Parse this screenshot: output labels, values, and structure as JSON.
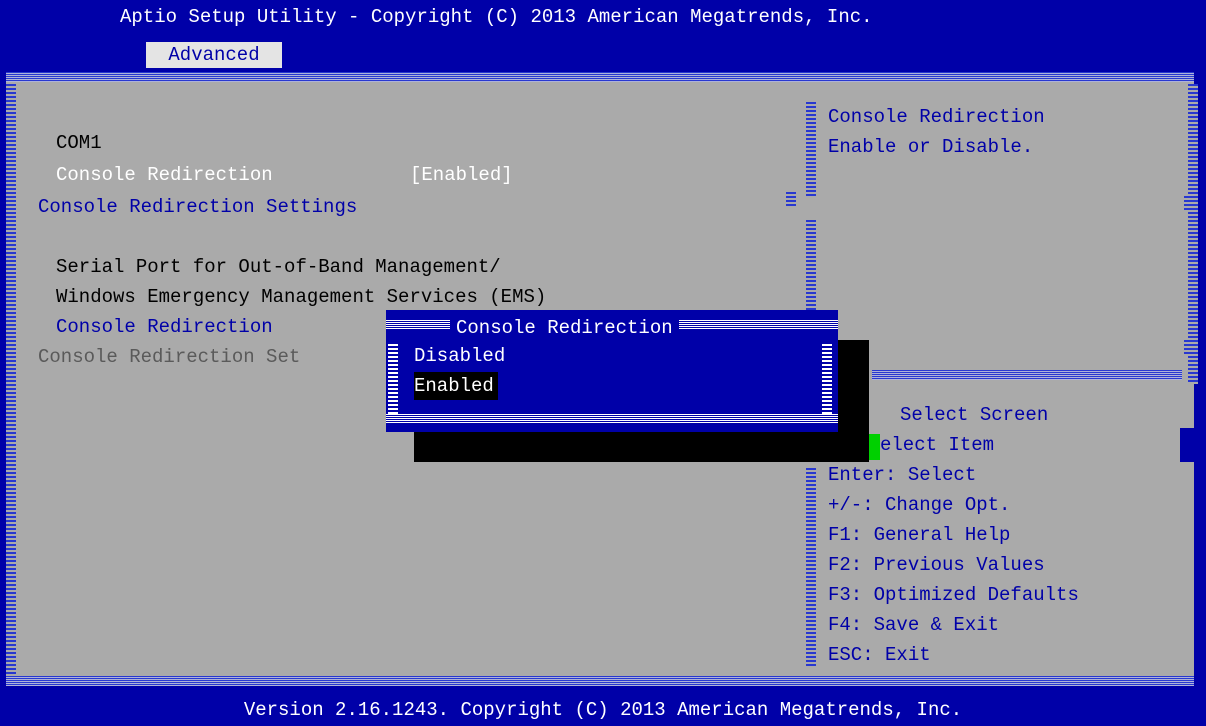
{
  "header": {
    "title": "Aptio Setup Utility - Copyright (C) 2013 American Megatrends, Inc.",
    "tabs": [
      {
        "label": "Advanced",
        "active": true
      }
    ]
  },
  "main": {
    "items": [
      {
        "label": "COM1"
      },
      {
        "label": "Console Redirection",
        "value": "[Enabled]"
      },
      {
        "label": "Console Redirection Settings"
      },
      {
        "label": "Serial Port for Out-of-Band Management/"
      },
      {
        "label": "Windows Emergency Management Services (EMS)"
      },
      {
        "label": "Console Redirection"
      },
      {
        "label": "Console Redirection Set"
      }
    ]
  },
  "help": {
    "lines": [
      "Console Redirection",
      "Enable or Disable."
    ]
  },
  "keys": {
    "lines": [
      "Select Screen",
      "elect Item",
      "Enter: Select",
      "+/-: Change Opt.",
      "F1: General Help",
      "F2: Previous Values",
      "F3: Optimized Defaults",
      "F4: Save & Exit",
      "ESC: Exit"
    ]
  },
  "popup": {
    "title": "Console Redirection",
    "options": [
      {
        "label": "Disabled",
        "selected": false
      },
      {
        "label": "Enabled",
        "selected": true
      }
    ]
  },
  "footer": {
    "text": "Version 2.16.1243. Copyright (C) 2013 American Megatrends, Inc."
  },
  "colors": {
    "background": "#0000a8",
    "panel": "#aaaaaa",
    "text_white": "#ffffff",
    "highlight": "#000000",
    "cursor": "#00d000"
  }
}
